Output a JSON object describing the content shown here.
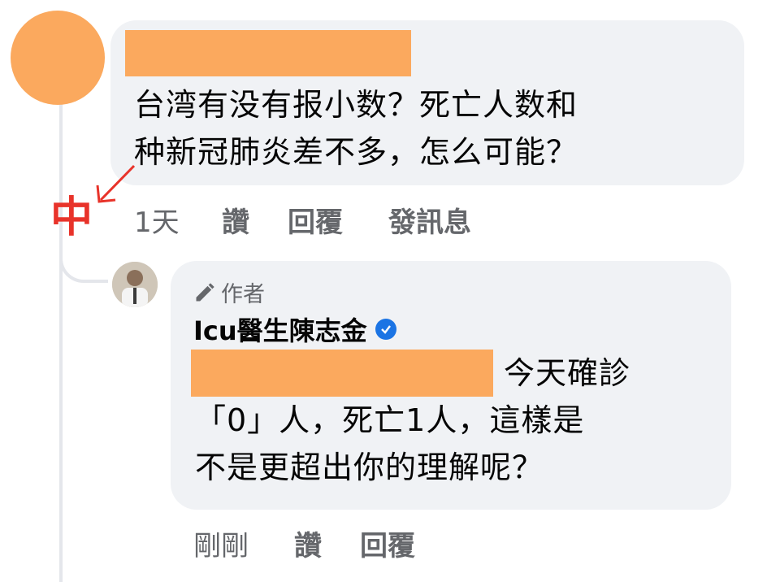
{
  "comment": {
    "text_lines": [
      "台湾有没有报小数？死亡人数和",
      "种新冠肺炎差不多，怎么可能？"
    ],
    "time": "1天",
    "actions": [
      "讚",
      "回覆",
      "發訊息"
    ],
    "avatar_color": "#fba95e",
    "redaction_color": "#fba95e"
  },
  "annotation": {
    "char": "中",
    "color": "#e8332a"
  },
  "reply": {
    "author_badge": "作者",
    "author_name": "Icu醫生陳志金",
    "text_line_1_tail": "今天確診",
    "text_lines": [
      "「0」人，死亡1人，這樣是",
      "不是更超出你的理解呢？"
    ],
    "time": "剛剛",
    "actions": [
      "讚",
      "回覆"
    ],
    "verified_color": "#1b74e4"
  },
  "colors": {
    "bubble_bg": "#f0f2f5",
    "meta_text": "#65676b",
    "thread_line": "#e4e6eb"
  }
}
